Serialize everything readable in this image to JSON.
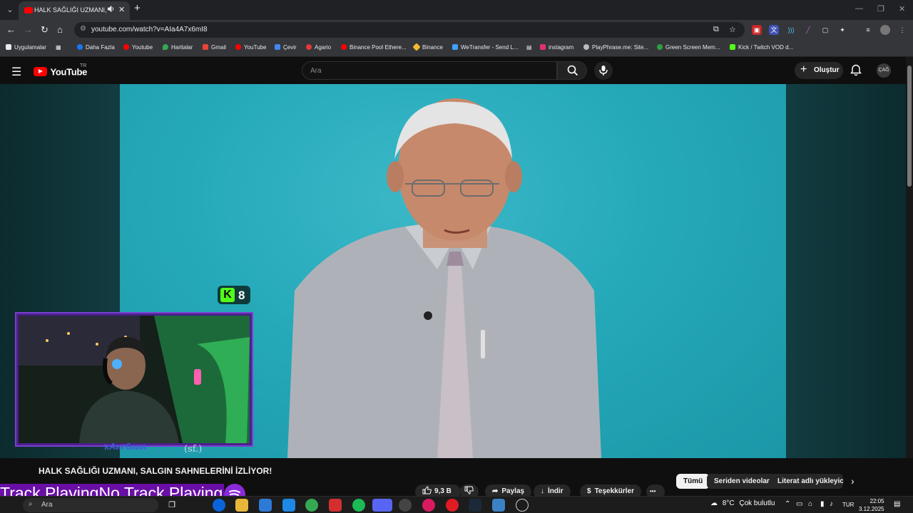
{
  "browser": {
    "tab_title": "HALK SAĞLIĞI UZMANI, SAL",
    "url": "youtube.com/watch?v=AIa4A7x6mI8",
    "audio_icon": "speaker-icon",
    "close_glyph": "✕",
    "new_tab_glyph": "+",
    "menu_glyph": "⌄"
  },
  "bookmarks": [
    {
      "label": "Uygulamalar",
      "color": "#e8eaed"
    },
    {
      "label": "Daha Fazla",
      "color": "#1877f2"
    },
    {
      "label": "Youtube",
      "color": "#ff0000"
    },
    {
      "label": "Haritalar",
      "color": "#34a853"
    },
    {
      "label": "Gmail",
      "color": "#ea4335"
    },
    {
      "label": "YouTube",
      "color": "#ff0000"
    },
    {
      "label": "Çevir",
      "color": "#4285f4"
    },
    {
      "label": "Agario",
      "color": "#e53935"
    },
    {
      "label": "Binance Pool Ethere...",
      "color": "#ff0000"
    },
    {
      "label": "Binance",
      "color": "#f3ba2f"
    },
    {
      "label": "WeTransfer - Send L...",
      "color": "#409fff"
    },
    {
      "label": "instagram",
      "color": "#e1306c"
    },
    {
      "label": "PlayPhrase.me: Site...",
      "color": "#bbbbbb"
    },
    {
      "label": "Green Screen Mem...",
      "color": "#2ea043"
    },
    {
      "label": "Kick / Twitch VOD d...",
      "color": "#53fc18"
    }
  ],
  "youtube": {
    "logo_text": "YouTube",
    "region": "TR",
    "search_placeholder": "Ara",
    "create_label": "Oluştur",
    "avatar_text": "ÇAĞ"
  },
  "overlay": {
    "kick_letter": "K",
    "kick_count": "8",
    "webcam_name": "ҡAᴎᴦ6ᴧᴎᴧ",
    "webcam_sub": "(sf.)",
    "track_text": "Track PlayingNo Track Playing"
  },
  "video": {
    "title": "HALK SAĞLIĞI UZMANI, SALGIN SAHNELERİNİ İZLİYOR!",
    "likes": "9,3 B",
    "share_label": "Paylaş",
    "download_label": "İndir",
    "thanks_label": "Teşekkürler",
    "more_glyph": "•••"
  },
  "chips": [
    {
      "label": "Tümü",
      "selected": true
    },
    {
      "label": "Seriden videolar",
      "selected": false
    },
    {
      "label": "Literat adlı yükleyicid",
      "selected": false
    }
  ],
  "taskbar": {
    "search_label": "Ara",
    "weather_temp": "8°C",
    "weather_desc": "Çok bulutlu",
    "lang": "TUR",
    "time": "22:05",
    "date": "3.12.2025"
  },
  "colors": {
    "youtube_red": "#ff0000",
    "kick_green": "#53fc18",
    "webcam_border": "#4b1f8c",
    "track_bg": "#6a0fa6",
    "video_bg": "#25a9b9"
  }
}
